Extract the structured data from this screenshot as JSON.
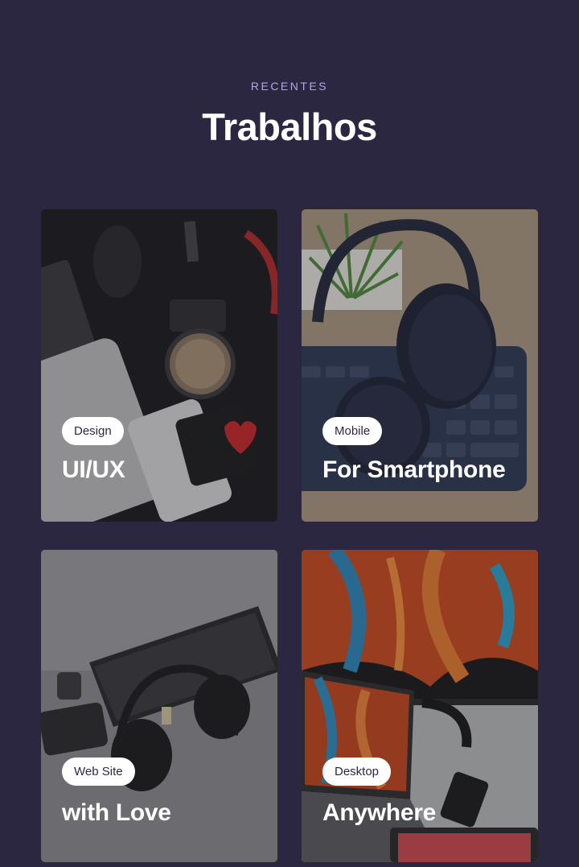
{
  "section": {
    "eyebrow": "RECENTES",
    "title": "Trabalhos"
  },
  "projects": [
    {
      "tag": "Design",
      "title": "UI/UX"
    },
    {
      "tag": "Mobile",
      "title": "For Smartphone"
    },
    {
      "tag": "Web Site",
      "title": "with Love"
    },
    {
      "tag": "Desktop",
      "title": "Anywhere"
    }
  ],
  "colors": {
    "background": "#2c2741",
    "accent": "#b3a6e6",
    "tag_bg": "#ffffff"
  }
}
